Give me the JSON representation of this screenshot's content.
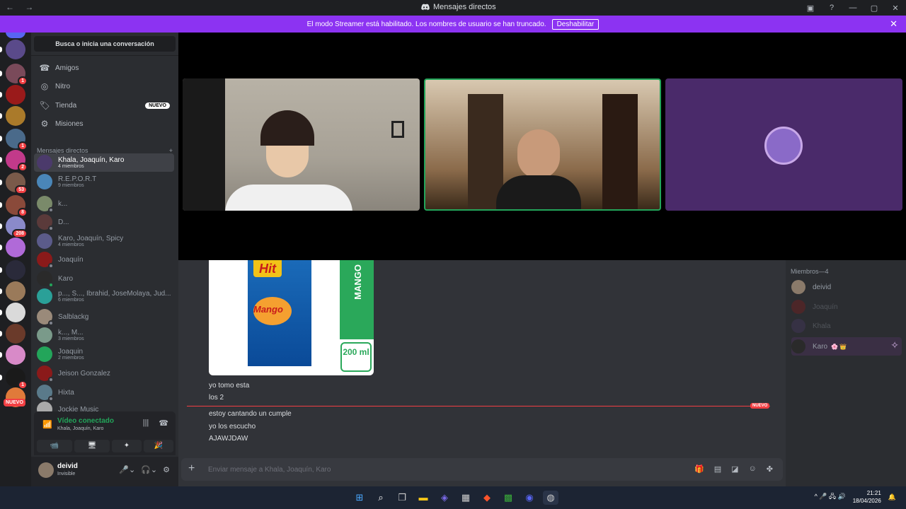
{
  "window": {
    "title": "Mensajes directos",
    "nav": "← →",
    "controls": [
      "▣",
      "?",
      "—",
      "▢",
      "✕"
    ]
  },
  "banner": {
    "text": "El modo Streamer está habilitado. Los nombres de usuario se han truncado.",
    "button": "Deshabilitar",
    "close": "✕"
  },
  "guild_badges": [
    "1",
    "2",
    "53",
    "8",
    "208",
    "1",
    "1"
  ],
  "guild_new_label": "NUEVO",
  "sidebar": {
    "search": "Busca o inicia una conversación",
    "nav": [
      {
        "label": "Amigos",
        "icon": "☎"
      },
      {
        "label": "Nitro",
        "icon": "◎"
      },
      {
        "label": "Tienda",
        "icon": "🏷",
        "tag": "NUEVO"
      },
      {
        "label": "Misiones",
        "icon": "⚙"
      }
    ],
    "dm_header": "Mensajes directos",
    "dm_add": "+",
    "dms": [
      {
        "name": "Khala, Joaquín, Karo",
        "sub": "4 miembros",
        "color": "#4b3a6b",
        "active": true
      },
      {
        "name": "R.E.P.O.R.T",
        "sub": "9 miembros",
        "color": "#4a86b8"
      },
      {
        "name": "k...",
        "sub": "",
        "color": "#7a8a6a",
        "status": "#80848e"
      },
      {
        "name": "D...",
        "sub": "",
        "color": "#5a3a3a",
        "status": "#80848e"
      },
      {
        "name": "Karo, Joaquín, Spicy",
        "sub": "4 miembros",
        "color": "#5b5b8a"
      },
      {
        "name": "Joaquín",
        "sub": "",
        "color": "#8a1a1a",
        "status": "#80848e"
      },
      {
        "name": "Karo",
        "sub": "",
        "color": "#2a2a2a",
        "status": "#23a55a"
      },
      {
        "name": "p..., S..., Ibrahid, JoseMolaya, Jud...",
        "sub": "6 miembros",
        "color": "#2aa098"
      },
      {
        "name": "Salblackg",
        "sub": "",
        "color": "#9a8a7a",
        "status": "#80848e"
      },
      {
        "name": "k..., M...",
        "sub": "3 miembros",
        "color": "#7a9a8a"
      },
      {
        "name": "Joaquin",
        "sub": "2 miembros",
        "color": "#23a55a"
      },
      {
        "name": "Jeison Gonzalez",
        "sub": "",
        "color": "#8a1a1a",
        "status": "#80848e"
      },
      {
        "name": "Hixta",
        "sub": "",
        "color": "#5a7a8a",
        "status": "#80848e"
      },
      {
        "name": "Jockie Music",
        "sub": "",
        "color": "#aaaaaa"
      }
    ]
  },
  "voice": {
    "status": "Vídeo conectado",
    "channel": "Khala, Joaquín, Karo",
    "controls": [
      "📹",
      "🖥",
      "✦",
      "🎉"
    ]
  },
  "user": {
    "name": "deivid",
    "status": "Invisible"
  },
  "chat": {
    "image_brand": "Hit",
    "image_flavor": "Mango",
    "image_side": "MANGO",
    "image_size": "200 ml",
    "messages_before": [
      "yo tomo esta",
      "los 2"
    ],
    "new_label": "NUEVO",
    "messages_after": [
      "estoy cantando un cumple",
      "yo los escucho",
      "AJAWJDAW"
    ],
    "placeholder": "Enviar mensaje a Khala, Joaquín, Karo"
  },
  "members": {
    "header": "Miembros—4",
    "list": [
      {
        "name": "deivid",
        "color": "#8a7a6a",
        "dim": false
      },
      {
        "name": "Joaquín",
        "color": "#8a1a1a",
        "dim": true
      },
      {
        "name": "Khala",
        "color": "#4b3a6b",
        "dim": true
      },
      {
        "name": "Karo",
        "color": "#2a2a2a",
        "dim": false,
        "badges": "🌸 👑"
      }
    ]
  },
  "taskbar": {
    "time": "21:21",
    "date": "18/04/2026",
    "tray": "^ 🎤 🖧 🔊"
  },
  "colors": {
    "accent": "#5865f2",
    "banner": "#8c33f2",
    "online": "#23a55a",
    "danger": "#f23f43"
  }
}
